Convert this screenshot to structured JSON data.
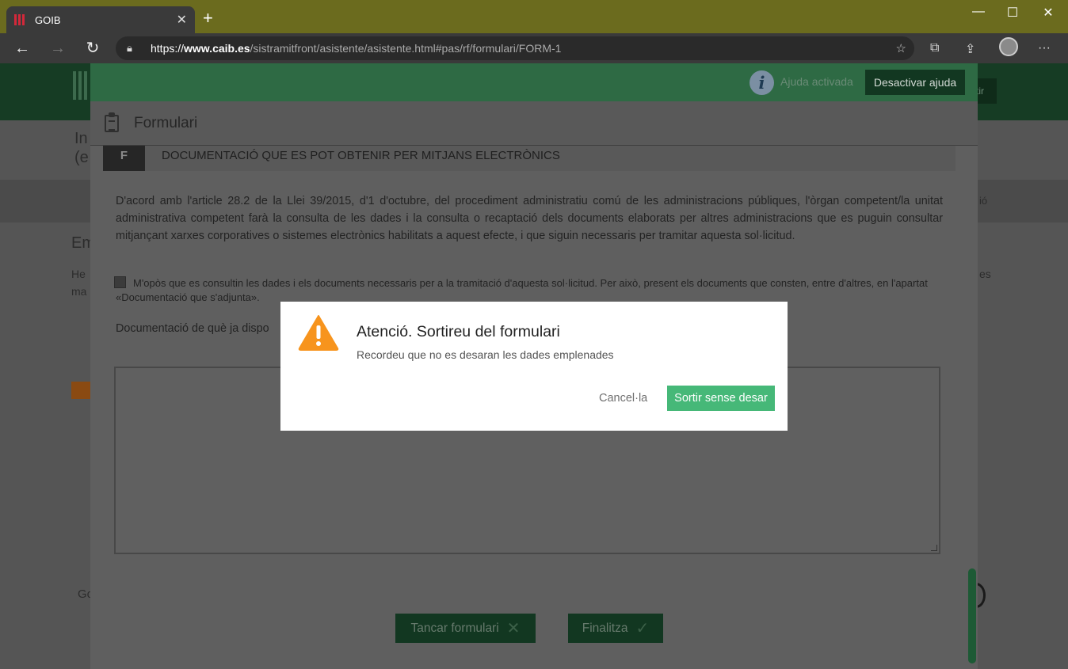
{
  "browser": {
    "tab_title": "GOIB",
    "tab_close": "✕",
    "new_tab": "+",
    "url_proto": "https://",
    "url_host": "www.caib.es",
    "url_path": "/sistramitfront/asistente/asistente.html#pas/rf/formulari/FORM-1",
    "icons": [
      "back-icon",
      "forward-icon",
      "refresh-icon",
      "lock-icon",
      "favorite-icon",
      "collections-icon",
      "share-icon",
      "profile-avatar",
      "more-icon"
    ]
  },
  "window_controls": {
    "minimize": "—",
    "maximize": "☐",
    "close": "✕"
  },
  "background": {
    "header_button": "tir",
    "fragments": [
      "In",
      "(e",
      "Em",
      "He",
      "ma",
      "Go",
      "es",
      "ió"
    ]
  },
  "help_bar": {
    "status": "Ajuda activada",
    "toggle_button": "Desactivar ajuda"
  },
  "form": {
    "title": "Formulari",
    "section_letter": "F",
    "section_title": "DOCUMENTACIÓ QUE ES POT OBTENIR PER MITJANS ELECTRÒNICS",
    "paragraph": "D'acord amb l'article 28.2 de la Llei 39/2015, d'1 d'octubre, del procediment administratiu comú de les administracions públiques, l'òrgan competent/la unitat administrativa competent farà la consulta de les dades i la consulta o recaptació dels documents elaborats per altres administracions que es puguin consultar mitjançant xarxes corporatives o sistemes electrònics habilitats a aquest efecte, i que siguin necessaris per tramitar aquesta sol·licitud.",
    "checkbox_label": "M'opòs que es consultin les dades i els documents necessaris per a la tramitació d'aquesta sol·licitud. Per això, present els documents que consten, entre d'altres, en l'apartat «Documentació que s'adjunta».",
    "doc_label": "Documentació de què ja dispo",
    "close_button": "Tancar formulari",
    "finish_button": "Finalitza"
  },
  "dialog": {
    "title": "Atenció. Sortireu del formulari",
    "message": "Recordeu que no es desaran les dades emplenades",
    "cancel": "Cancel·la",
    "confirm": "Sortir sense desar"
  },
  "colors": {
    "accent_green": "#46b878",
    "help_bar": "#2e6a44",
    "warning": "#f7941d"
  }
}
